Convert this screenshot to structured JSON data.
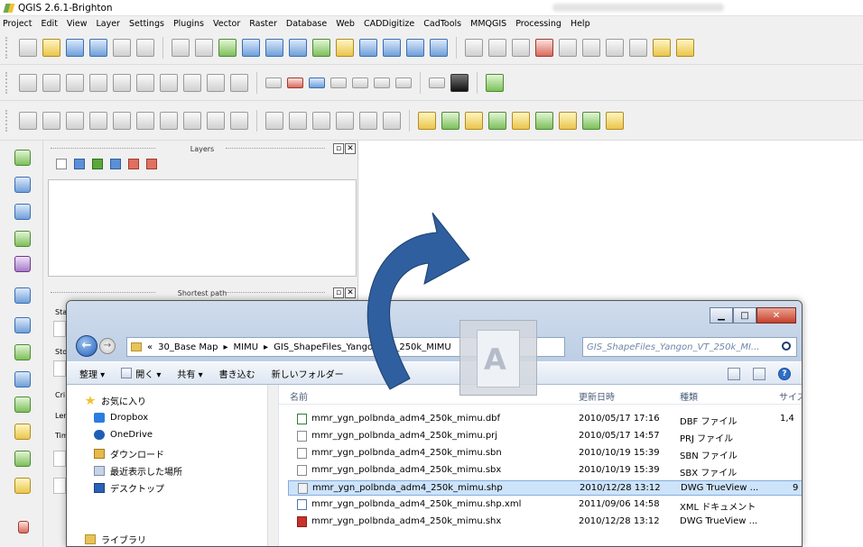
{
  "window_title": "QGIS 2.6.1-Brighton",
  "menu": [
    "Project",
    "Edit",
    "View",
    "Layer",
    "Settings",
    "Plugins",
    "Vector",
    "Raster",
    "Database",
    "Web",
    "CADDigitize",
    "CadTools",
    "MMQGIS",
    "Processing",
    "Help"
  ],
  "layers_panel": {
    "title": "Layers"
  },
  "shortest_path_panel": {
    "title": "Shortest path",
    "labels": [
      "Sta",
      "Sto",
      "Cri",
      "Ler",
      "Tim"
    ]
  },
  "explorer": {
    "breadcrumb": [
      "«",
      "30_Base Map",
      "▸",
      "MIMU",
      "▸",
      "GIS_ShapeFiles_Yangon_VT_250k_MIMU"
    ],
    "search_placeholder": "GIS_ShapeFiles_Yangon_VT_250k_MI...",
    "commands": [
      "整理 ▾",
      "開く ▾",
      "共有 ▾",
      "書き込む",
      "新しいフォルダー"
    ],
    "nav": [
      "お気に入り",
      "Dropbox",
      "OneDrive",
      "ダウンロード",
      "最近表示した場所",
      "デスクトップ",
      "ライブラリ"
    ],
    "columns": [
      "名前",
      "更新日時",
      "種類",
      "サイズ"
    ],
    "files": [
      {
        "name": "mmr_ygn_polbnda_adm4_250k_mimu.dbf",
        "date": "2010/05/17 17:16",
        "type": "DBF ファイル",
        "size": "1,4"
      },
      {
        "name": "mmr_ygn_polbnda_adm4_250k_mimu.prj",
        "date": "2010/05/17 14:57",
        "type": "PRJ ファイル",
        "size": ""
      },
      {
        "name": "mmr_ygn_polbnda_adm4_250k_mimu.sbn",
        "date": "2010/10/19 15:39",
        "type": "SBN ファイル",
        "size": ""
      },
      {
        "name": "mmr_ygn_polbnda_adm4_250k_mimu.sbx",
        "date": "2010/10/19 15:39",
        "type": "SBX ファイル",
        "size": ""
      },
      {
        "name": "mmr_ygn_polbnda_adm4_250k_mimu.shp",
        "date": "2010/12/28 13:12",
        "type": "DWG TrueView ...",
        "size": "9"
      },
      {
        "name": "mmr_ygn_polbnda_adm4_250k_mimu.shp.xml",
        "date": "2011/09/06 14:58",
        "type": "XML ドキュメント",
        "size": ""
      },
      {
        "name": "mmr_ygn_polbnda_adm4_250k_mimu.shx",
        "date": "2010/12/28 13:12",
        "type": "DWG TrueView ...",
        "size": ""
      }
    ]
  },
  "colors": {
    "arrow": "#2f5f9e",
    "selection": "#cde3fa"
  }
}
